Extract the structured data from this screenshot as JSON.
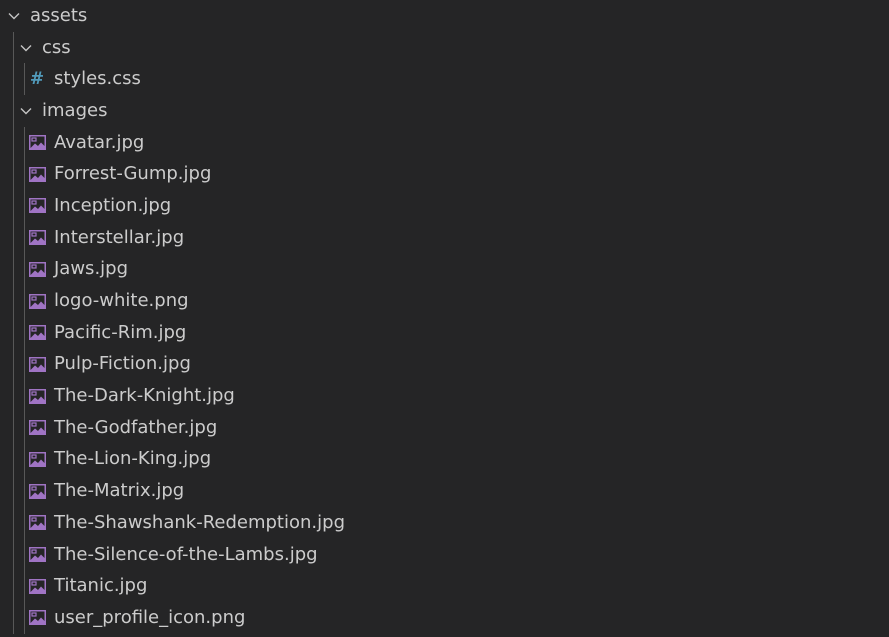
{
  "colors": {
    "background": "#252526",
    "text": "#cccccc",
    "chevron": "#c5c5c5",
    "image_icon": "#a074c4",
    "css_icon": "#519aba",
    "indent_guide": "#585858"
  },
  "tree": {
    "root": {
      "label": "assets",
      "icon": "chevron-down-icon"
    },
    "css_folder": {
      "label": "css",
      "icon": "chevron-down-icon"
    },
    "css_files": [
      {
        "label": "styles.css",
        "icon": "hash-icon",
        "glyph": "#"
      }
    ],
    "images_folder": {
      "label": "images",
      "icon": "chevron-down-icon"
    },
    "image_files": [
      {
        "label": "Avatar.jpg",
        "icon": "image-icon"
      },
      {
        "label": "Forrest-Gump.jpg",
        "icon": "image-icon"
      },
      {
        "label": "Inception.jpg",
        "icon": "image-icon"
      },
      {
        "label": "Interstellar.jpg",
        "icon": "image-icon"
      },
      {
        "label": "Jaws.jpg",
        "icon": "image-icon"
      },
      {
        "label": "logo-white.png",
        "icon": "image-icon"
      },
      {
        "label": "Pacific-Rim.jpg",
        "icon": "image-icon"
      },
      {
        "label": "Pulp-Fiction.jpg",
        "icon": "image-icon"
      },
      {
        "label": "The-Dark-Knight.jpg",
        "icon": "image-icon"
      },
      {
        "label": "The-Godfather.jpg",
        "icon": "image-icon"
      },
      {
        "label": "The-Lion-King.jpg",
        "icon": "image-icon"
      },
      {
        "label": "The-Matrix.jpg",
        "icon": "image-icon"
      },
      {
        "label": "The-Shawshank-Redemption.jpg",
        "icon": "image-icon"
      },
      {
        "label": "The-Silence-of-the-Lambs.jpg",
        "icon": "image-icon"
      },
      {
        "label": "Titanic.jpg",
        "icon": "image-icon"
      },
      {
        "label": "user_profile_icon.png",
        "icon": "image-icon"
      }
    ]
  }
}
